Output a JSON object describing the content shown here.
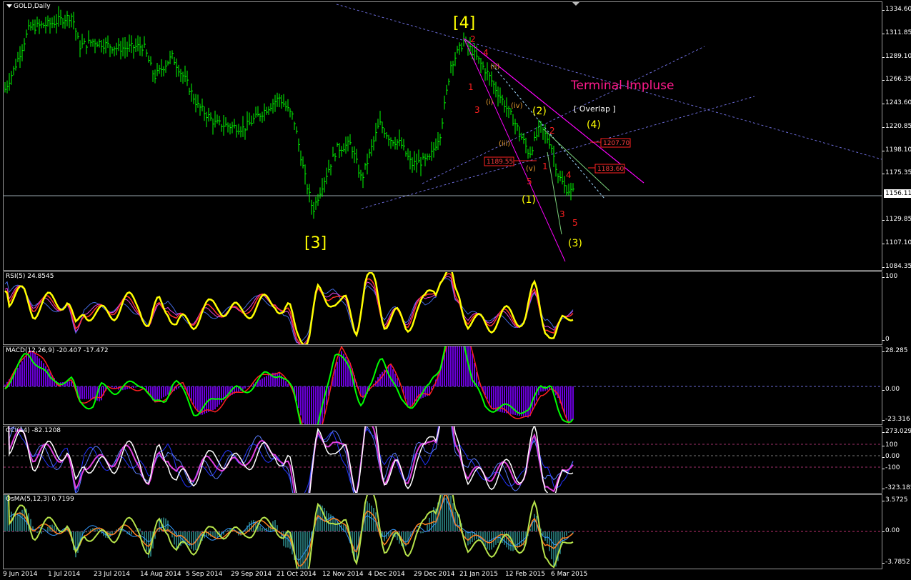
{
  "symbol_label": "GOLD,Daily",
  "current_price": "1156.11",
  "price_axis": [
    "1334.60",
    "1311.85",
    "1289.10",
    "1266.35",
    "1243.60",
    "1220.85",
    "1198.10",
    "1175.35",
    "1152.60",
    "1129.85",
    "1107.10",
    "1084.35"
  ],
  "annotations": {
    "wave_4_major": "[4]",
    "wave_3_major": "[3]",
    "terminal_impulse": "Terminal Impluse",
    "overlap": "[ Overlap ]",
    "wave_1_minor": "(1)",
    "wave_2_minor": "(2)",
    "wave_3_minor": "(3)",
    "wave_4_minor": "(4)",
    "sub_i": "(i)",
    "sub_ii": "(ii)",
    "sub_iii": "(iii)",
    "sub_iv": "(iv)",
    "sub_v": "(v)",
    "red_1a": "1",
    "red_2a": "2",
    "red_3a": "3",
    "red_4a": "4",
    "red_5a": "5",
    "red_1b": "1",
    "red_2b": "2",
    "red_3b": "3",
    "red_4b": "4",
    "red_5b": "5",
    "level_1207": "1207.70",
    "level_1189": "1189.55",
    "level_1183": "1183.60"
  },
  "indicators": {
    "rsi": {
      "label": "RSI(5) 24.8545",
      "axis": [
        "100",
        "0"
      ]
    },
    "macd": {
      "label": "MACD(12,26,9) -20.407 -17.472",
      "axis": [
        "28.285",
        "0.00",
        "-23.316"
      ]
    },
    "cci": {
      "label": "CCI(14) -82.1208",
      "axis": [
        "273.0297",
        "100",
        "0.00",
        "-100",
        "-323.185"
      ]
    },
    "osma": {
      "label": "OsMA(5,12,3) 0.7199",
      "axis": [
        "3.5725",
        "0.00",
        "-3.7852"
      ]
    }
  },
  "date_axis": [
    "9 Jun 2014",
    "1 Jul 2014",
    "23 Jul 2014",
    "14 Aug 2014",
    "5 Sep 2014",
    "29 Sep 2014",
    "21 Oct 2014",
    "12 Nov 2014",
    "4 Dec 2014",
    "29 Dec 2014",
    "21 Jan 2015",
    "12 Feb 2015",
    "6 Mar 2015"
  ],
  "colors": {
    "bars": "#00ff00",
    "wave_red": "#ff2020",
    "wave_yellow": "#ffff00",
    "magenta": "#ff00ff",
    "label_pink": "#ff1a8c",
    "grid_dash": "#6b6bd8"
  },
  "chart_data": {
    "type": "line",
    "title": "GOLD,Daily",
    "x": [
      "9 Jun 2014",
      "1 Jul 2014",
      "23 Jul 2014",
      "14 Aug 2014",
      "5 Sep 2014",
      "29 Sep 2014",
      "21 Oct 2014",
      "12 Nov 2014",
      "4 Dec 2014",
      "29 Dec 2014",
      "21 Jan 2015",
      "12 Feb 2015",
      "6 Mar 2015"
    ],
    "series": [
      {
        "values": [
          1255,
          1322,
          1305,
          1300,
          1268,
          1216,
          1245,
          1160,
          1210,
          1195,
          1300,
          1215,
          1158
        ]
      }
    ],
    "ylim": [
      1084.35,
      1334.6
    ],
    "grid": false
  }
}
